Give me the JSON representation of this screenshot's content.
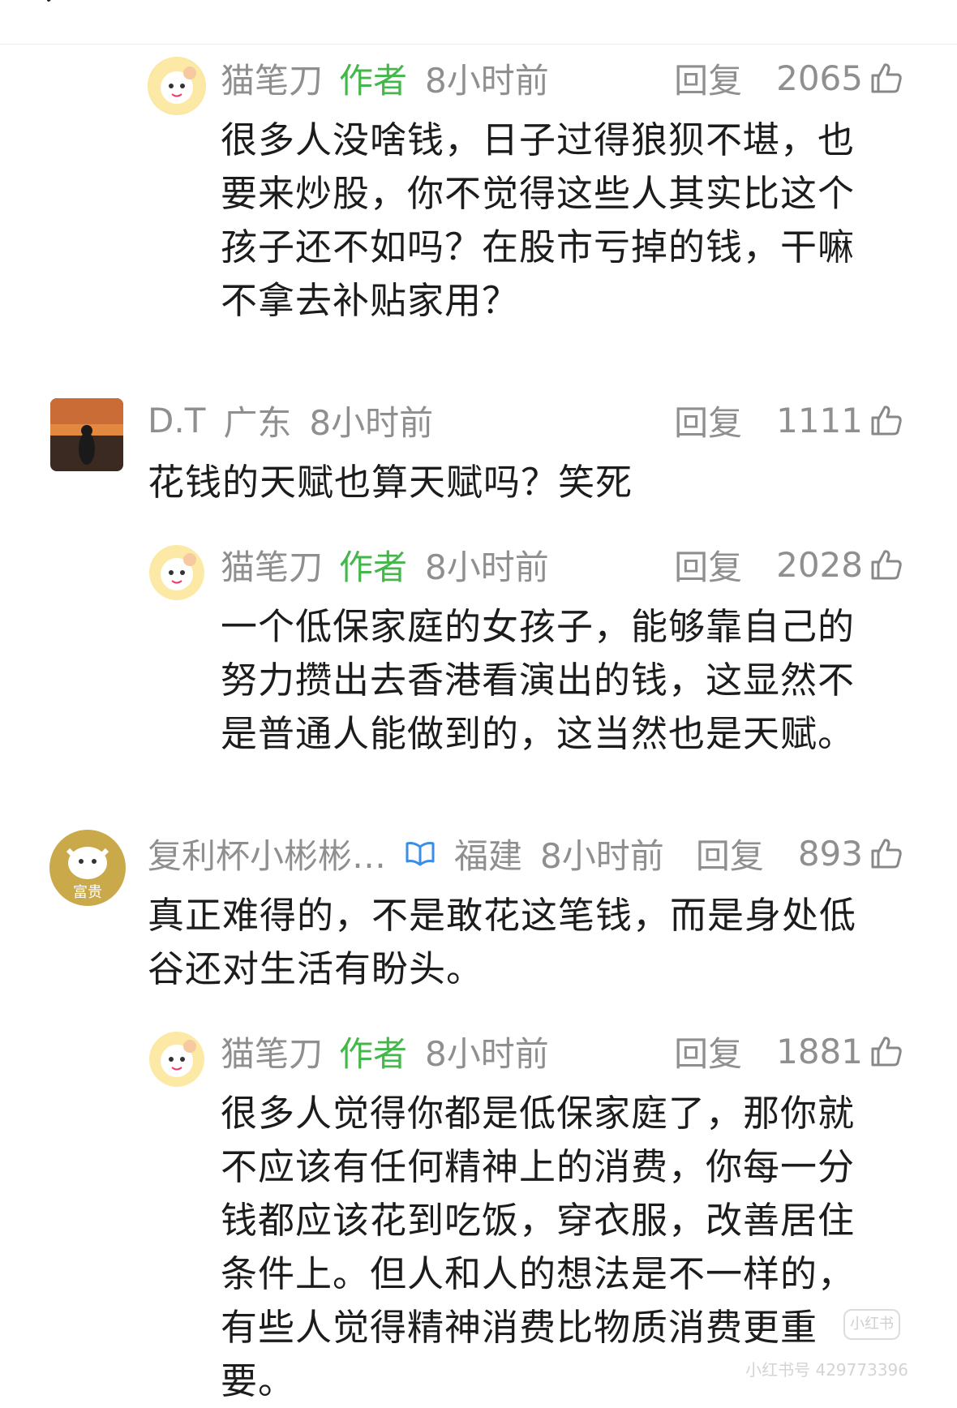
{
  "comments": [
    {
      "username": "猫笔刀",
      "badge": "作者",
      "location": "",
      "time": "8小时前",
      "reply_label": "回复",
      "likes": "2065",
      "text": "很多人没啥钱，日子过得狼狈不堪，也要来炒股，你不觉得这些人其实比这个孩子还不如吗？在股市亏掉的钱，干嘛不拿去补贴家用？"
    },
    {
      "username": "D.T",
      "badge": "",
      "location": "广东",
      "time": "8小时前",
      "reply_label": "回复",
      "likes": "1111",
      "text": "花钱的天赋也算天赋吗？笑死"
    },
    {
      "username": "猫笔刀",
      "badge": "作者",
      "location": "",
      "time": "8小时前",
      "reply_label": "回复",
      "likes": "2028",
      "text": "一个低保家庭的女孩子，能够靠自己的努力攒出去香港看演出的钱，这显然不是普通人能做到的，这当然也是天赋。"
    },
    {
      "username": "复利杯小彬彬…",
      "badge": "",
      "location": "福建",
      "time": "8小时前",
      "reply_label": "回复",
      "likes": "893",
      "text": "真正难得的，不是敢花这笔钱，而是身处低谷还对生活有盼头。"
    },
    {
      "username": "猫笔刀",
      "badge": "作者",
      "location": "",
      "time": "8小时前",
      "reply_label": "回复",
      "likes": "1881",
      "text": "很多人觉得你都是低保家庭了，那你就不应该有任何精神上的消费，你每一分钱都应该花到吃饭，穿衣服，改善居住条件上。但人和人的想法是不一样的，有些人觉得精神消费比物质消费更重要。"
    }
  ],
  "avatar_text": {
    "fuli": "富贵"
  },
  "watermark": {
    "text": "小红书号 429773396",
    "logo": "小红书"
  },
  "icons": {
    "back": "chevron-left-icon",
    "like": "thumbs-up-icon",
    "verified": "book-icon"
  },
  "colors": {
    "author_badge": "#43b74a",
    "meta_gray": "#8f8f8f",
    "body_text": "#1c1c1c",
    "verified_blue": "#3a8ee6"
  }
}
